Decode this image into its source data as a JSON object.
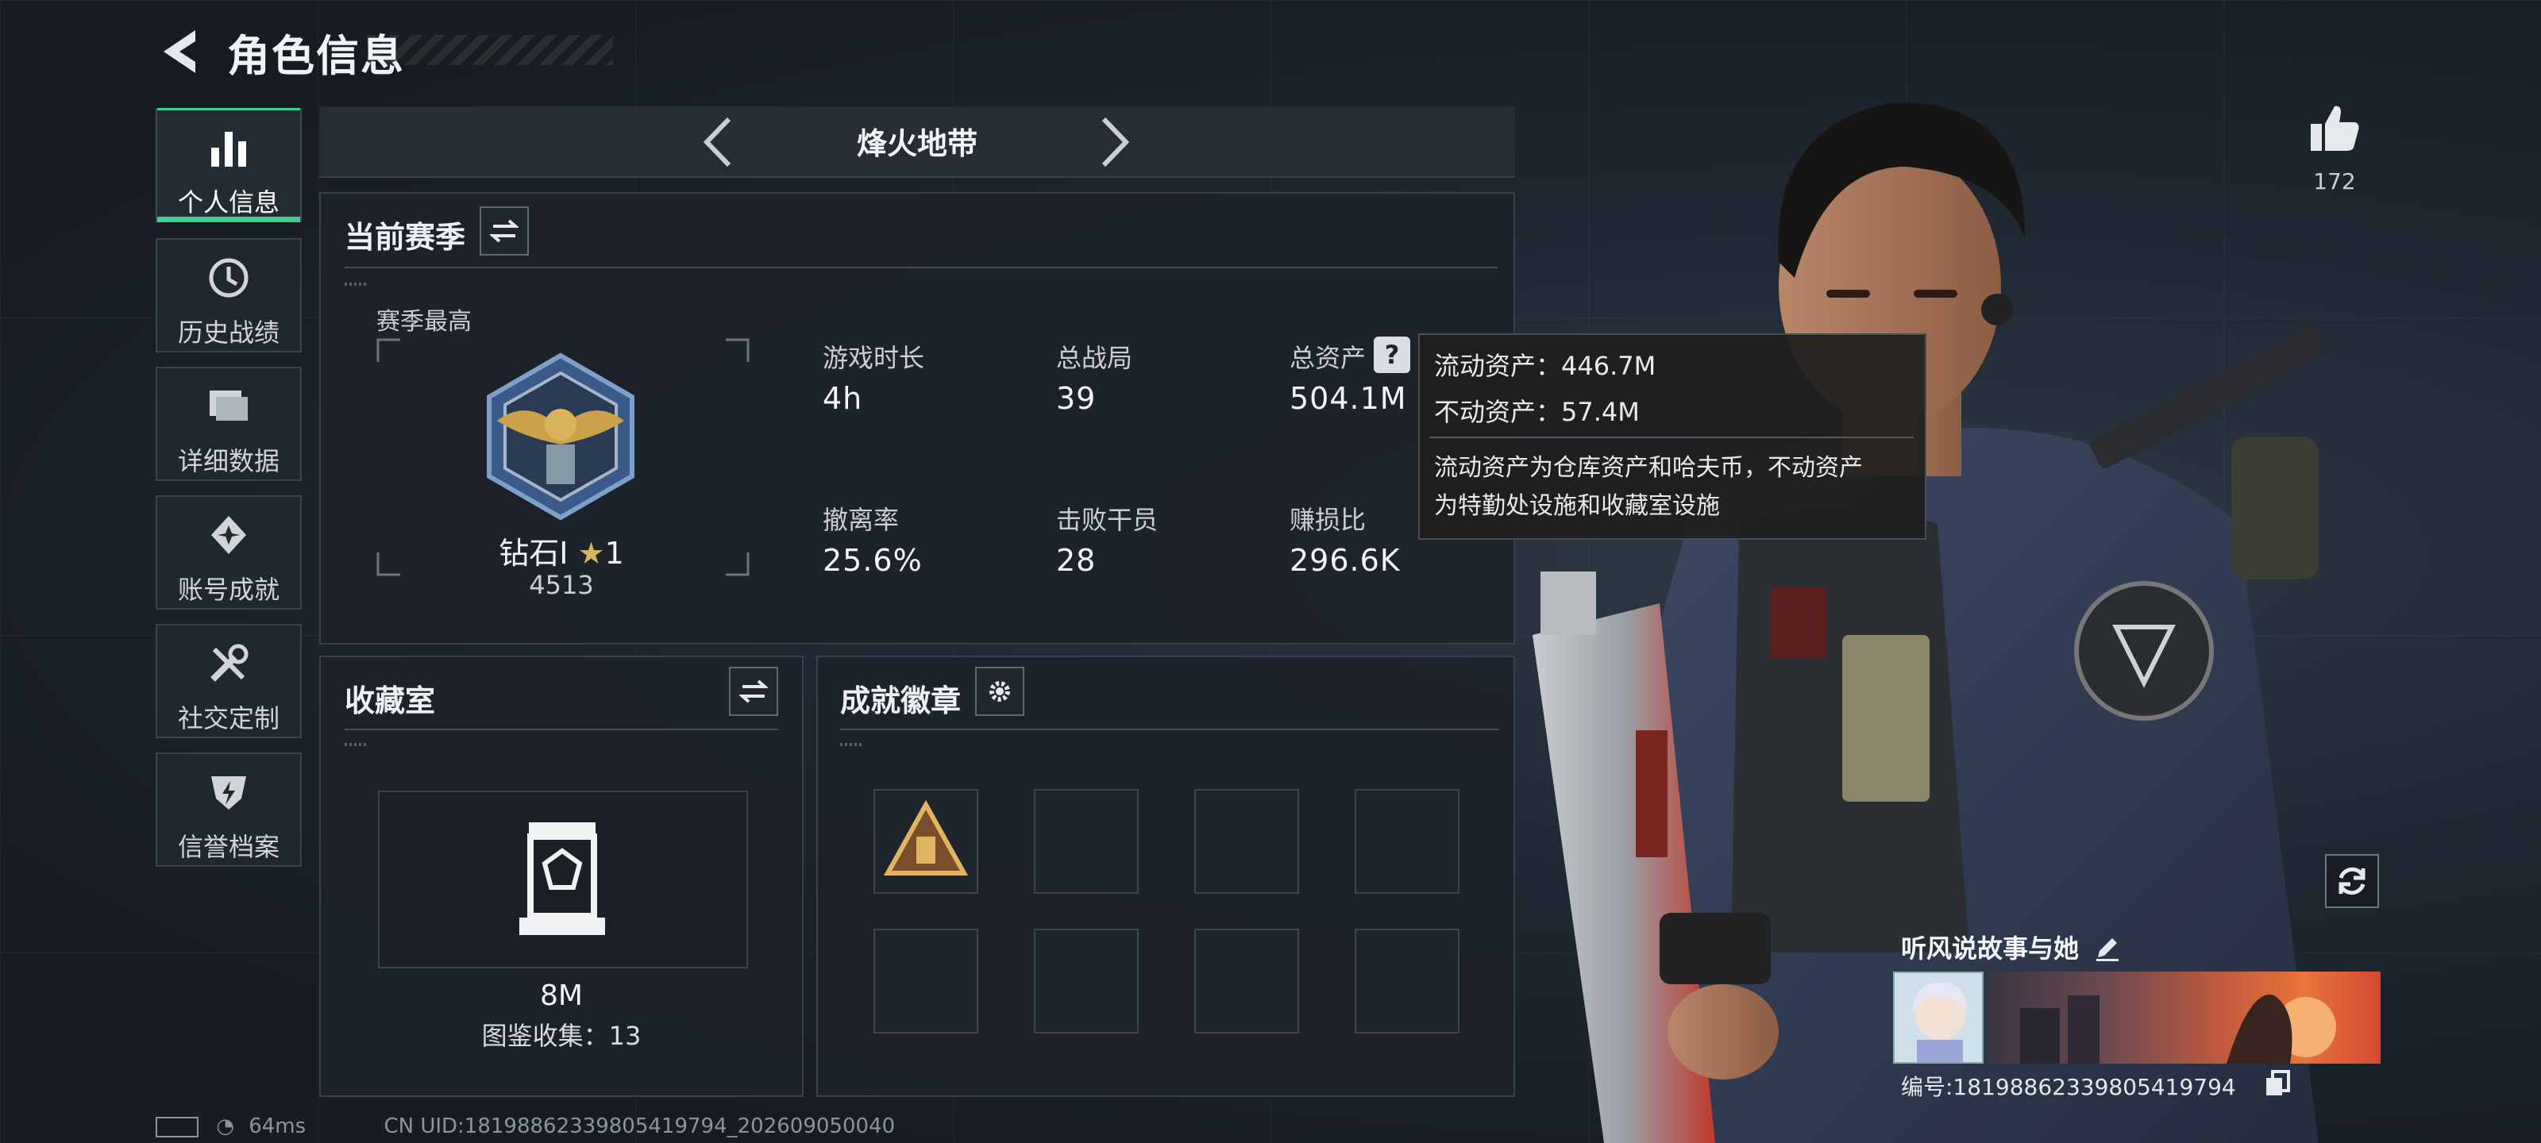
{
  "header": {
    "title": "角色信息"
  },
  "sidebar": {
    "items": [
      {
        "label": "个人信息",
        "icon": "bar-chart-icon",
        "active": true
      },
      {
        "label": "历史战绩",
        "icon": "history-icon",
        "active": false
      },
      {
        "label": "详细数据",
        "icon": "folder-icon",
        "active": false
      },
      {
        "label": "账号成就",
        "icon": "achievement-icon",
        "active": false
      },
      {
        "label": "社交定制",
        "icon": "tools-icon",
        "active": false
      },
      {
        "label": "信誉档案",
        "icon": "shield-icon",
        "active": false
      }
    ]
  },
  "mode": {
    "title": "烽火地带"
  },
  "season": {
    "title": "当前赛季",
    "best_label": "赛季最高",
    "rank_name": "钻石Ⅰ",
    "rank_stars": "1",
    "rank_points": "4513",
    "stats": [
      {
        "label": "游戏时长",
        "value": "4h"
      },
      {
        "label": "总战局",
        "value": "39"
      },
      {
        "label": "总资产",
        "value": "504.1M"
      },
      {
        "label": "撤离率",
        "value": "25.6%"
      },
      {
        "label": "击败干员",
        "value": "28"
      },
      {
        "label": "赚损比",
        "value": "296.6K"
      }
    ]
  },
  "tooltip": {
    "liquid": "流动资产：446.7M",
    "fixed": "不动资产：57.4M",
    "desc_line1": "流动资产为仓库资产和哈夫币，不动资产",
    "desc_line2": "为特勤处设施和收藏室设施"
  },
  "collection": {
    "title": "收藏室",
    "value": "8M",
    "count_text": "图鉴收集：13"
  },
  "achievements": {
    "title": "成就徽章",
    "slots": 8
  },
  "likes": {
    "count": "172"
  },
  "player": {
    "name": "听风说故事与她",
    "id_text": "编号:18198862339805419794"
  },
  "status": {
    "ping": "64ms",
    "uid": "CN UID:18198862339805419794_202609050040"
  },
  "colors": {
    "accent": "#3fcf8e",
    "panel": "#1d232a",
    "gold": "#c9a24a"
  }
}
